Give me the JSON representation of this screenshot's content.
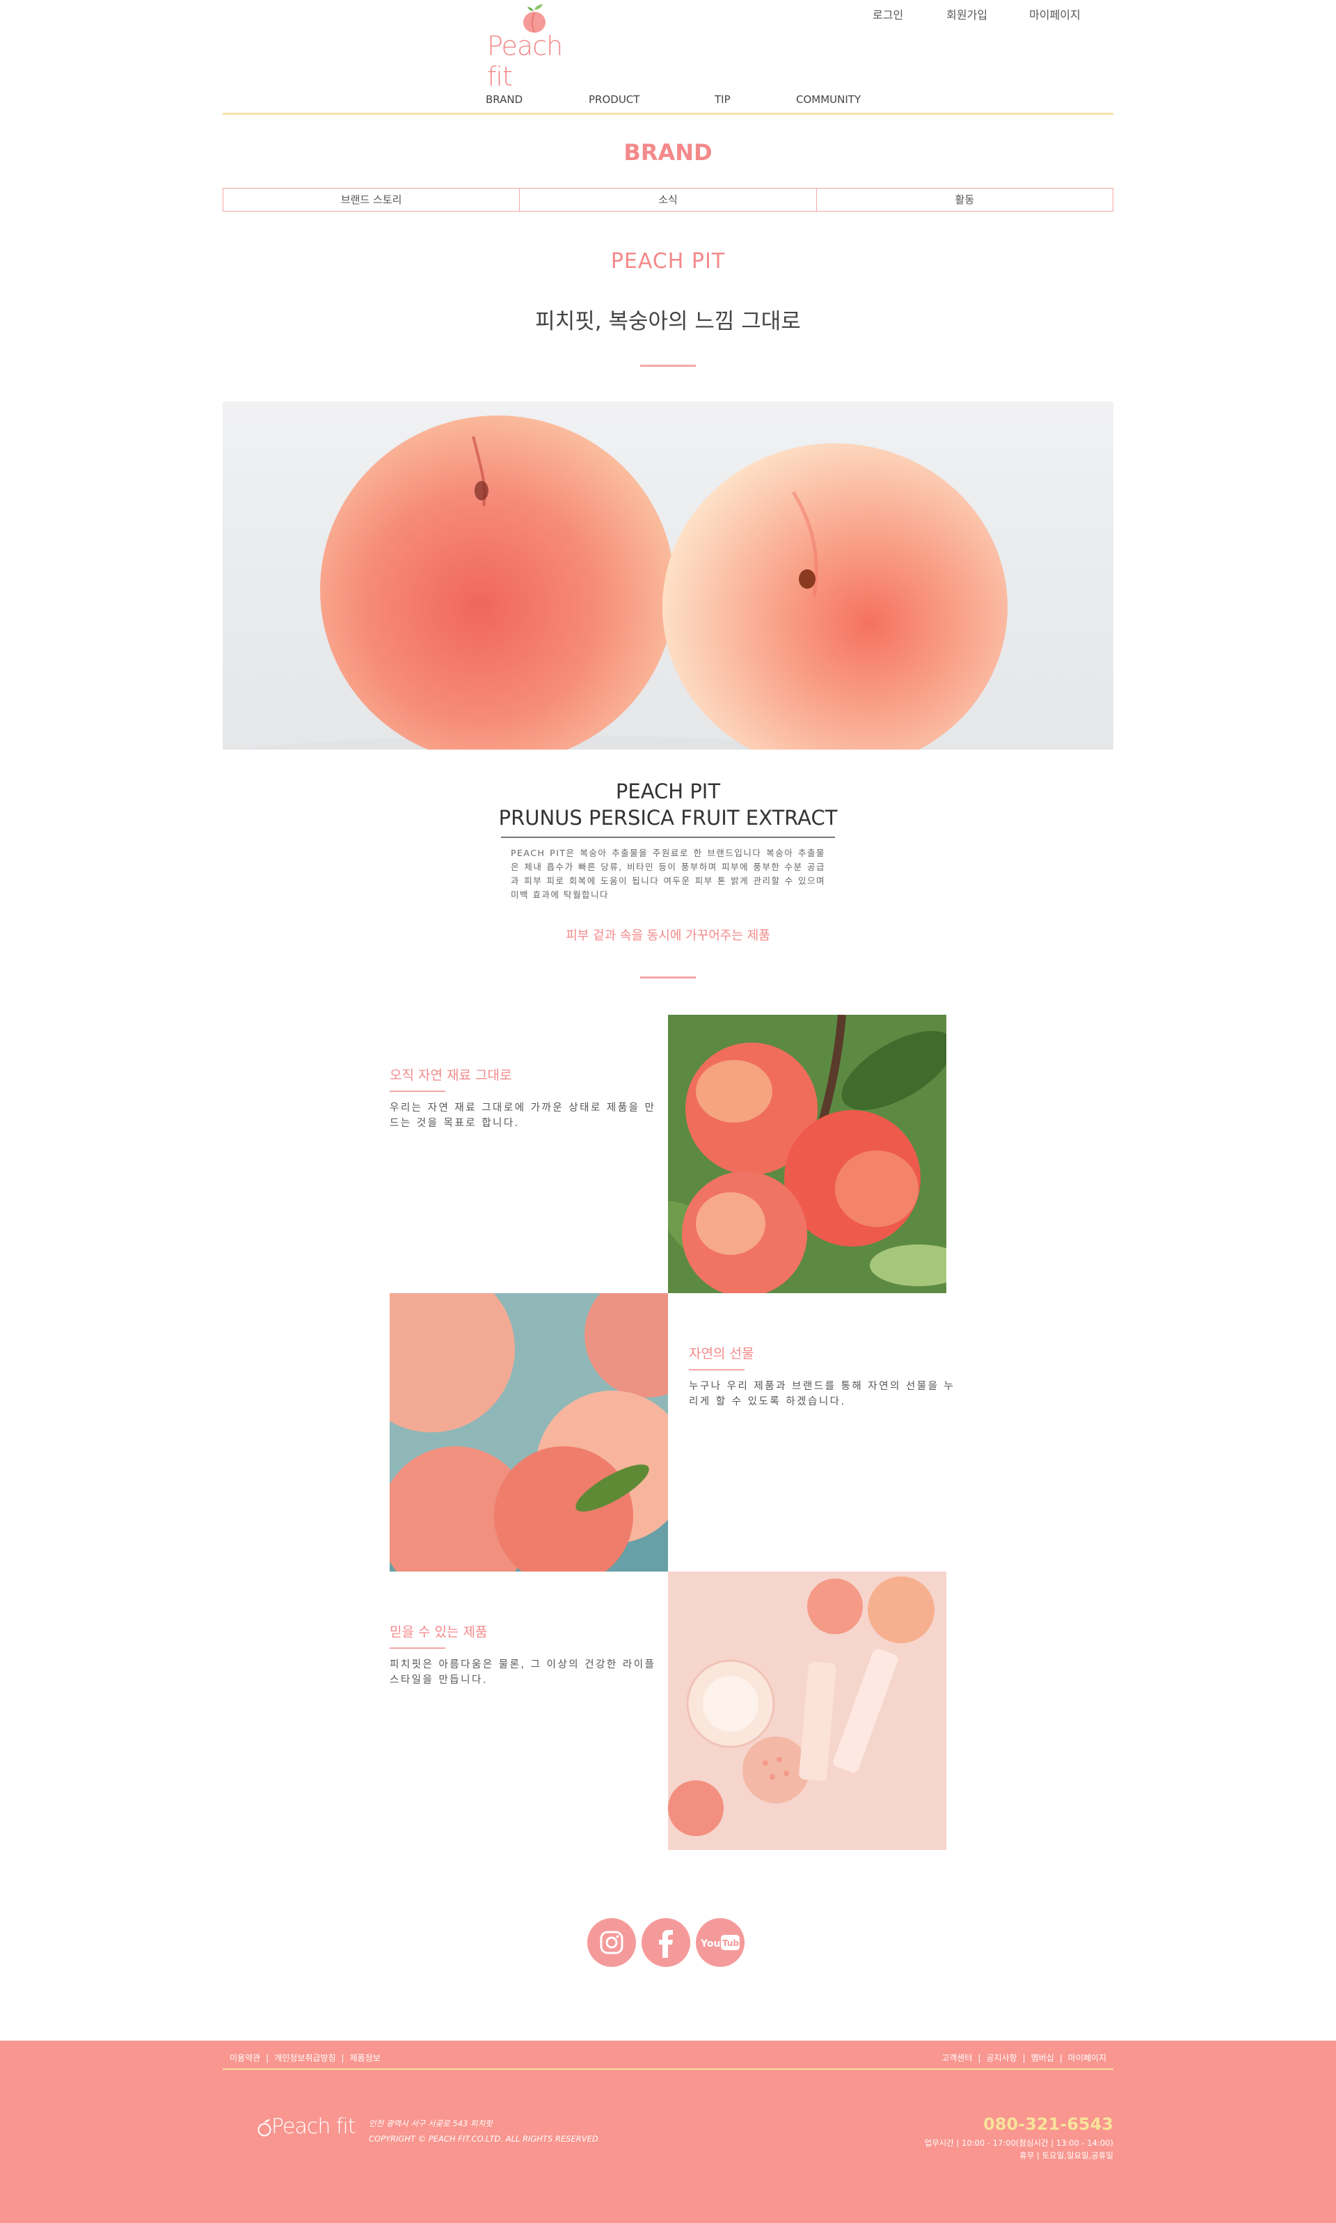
{
  "header": {
    "brand": "Peach fit",
    "util_nav": [
      "로그인",
      "회원가입",
      "마이페이지"
    ],
    "gnb": [
      "BRAND",
      "PRODUCT",
      "TIP",
      "COMMUNITY"
    ]
  },
  "page": {
    "section_title": "BRAND",
    "subtabs": [
      "브랜드 스토리",
      "소식",
      "활동"
    ]
  },
  "intro": {
    "title": "PEACH PIT",
    "subtitle": "피치핏, 복숭아의 느낌 그대로"
  },
  "extract": {
    "title_line1": "PEACH PIT",
    "title_line2": "PRUNUS PERSICA FRUIT EXTRACT",
    "description": "PEACH PIT은 복숭아 추출물을 주원료로 한 브랜드입니다 복숭아 추출물은 체내 흡수가 빠른 당류, 비타민 등이 풍부하며 피부에 풍부한 수분 공급과 피부 피로 회복에 도움이 됩니다 여두운 피부 톤 밝게 관리할 수 있으며 미백 효과에 탁월합니다",
    "highlight": "피부 겉과 속을 동시에 가꾸어주는 제품"
  },
  "features": [
    {
      "title": "오직 자연 재료 그대로",
      "desc": "우리는 자연 재료 그대로에 가까운 상태로 제품을 만드는 것을 목표로 합니다."
    },
    {
      "title": "자연의 선물",
      "desc": "누구나 우리 제품과 브랜드를 통해 자연의 선물을 누리게 할 수 있도록 하겠습니다."
    },
    {
      "title": "믿을 수 있는 제품",
      "desc": "피치핏은 아름다움은 물론, 그 이상의 건강한 라이플 스타일을 만듭니다."
    }
  ],
  "sns": {
    "youtube_label": "YouTube"
  },
  "footer": {
    "links_left": [
      "이용약관",
      "개인정보취급방침",
      "제품정보"
    ],
    "links_right": [
      "고객센터",
      "공지사항",
      "멤버십",
      "마이페이지"
    ],
    "logo": "Peach fit",
    "address": "인천 광역시 서구 서곶로 543 피치핏",
    "copyright": "COPYRIGHT © PEACH FIT.CO.LTD. ALL RIGHTS RESERVED",
    "phone": "080-321-6543",
    "hours_line1": "업무시간 | 10:00 - 17:00(점심시간 | 13:00 - 14:00)",
    "hours_line2": "휴무 | 토요일,일요일,공휴일"
  },
  "colors": {
    "accent": "#f3898a",
    "accent_border": "#f3a6a4",
    "gnb_line": "#f8e2a6",
    "footer_bg": "#f8968f",
    "phone": "#f8e39a"
  }
}
